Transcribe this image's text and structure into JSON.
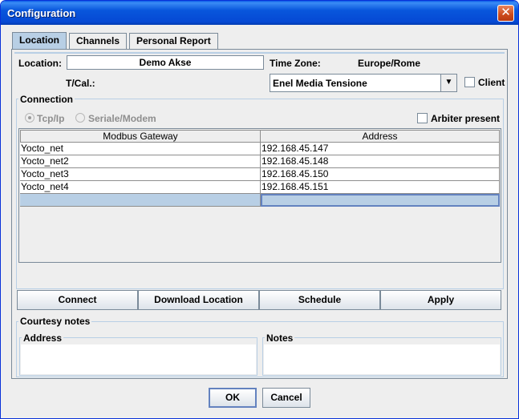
{
  "window": {
    "title": "Configuration",
    "close_glyph": "✕"
  },
  "tabs": [
    {
      "label": "Location",
      "active": true
    },
    {
      "label": "Channels",
      "active": false
    },
    {
      "label": "Personal Report",
      "active": false
    }
  ],
  "location": {
    "location_label": "Location:",
    "location_value": "Demo Akse",
    "timezone_label": "Time Zone:",
    "timezone_value": "Europe/Rome",
    "tcal_label": "T/Cal.:",
    "tcal_selected": "Enel Media Tensione",
    "client_label": "Client",
    "client_checked": false
  },
  "connection": {
    "title": "Connection",
    "radio_tcp": "Tcp/Ip",
    "radio_serial": "Seriale/Modem",
    "selected": "Tcp/Ip",
    "arbiter_label": "Arbiter present",
    "arbiter_checked": false
  },
  "table": {
    "columns": [
      "Modbus Gateway",
      "Address"
    ],
    "rows": [
      [
        "Yocto_net",
        "192.168.45.147"
      ],
      [
        "Yocto_net2",
        "192.168.45.148"
      ],
      [
        "Yocto_net3",
        "192.168.45.150"
      ],
      [
        "Yocto_net4",
        "192.168.45.151"
      ],
      [
        "",
        ""
      ]
    ]
  },
  "actions": {
    "connect": "Connect",
    "download": "Download Location",
    "schedule": "Schedule",
    "apply": "Apply"
  },
  "courtesy": {
    "title": "Courtesy notes",
    "address_label": "Address",
    "notes_label": "Notes",
    "address_value": "",
    "notes_value": ""
  },
  "dialog": {
    "ok": "OK",
    "cancel": "Cancel"
  },
  "icons": {
    "dropdown": "▼"
  },
  "colors": {
    "title_bar": "#0856dc",
    "selection": "#b8cfe5",
    "close": "#cc4a1c"
  }
}
